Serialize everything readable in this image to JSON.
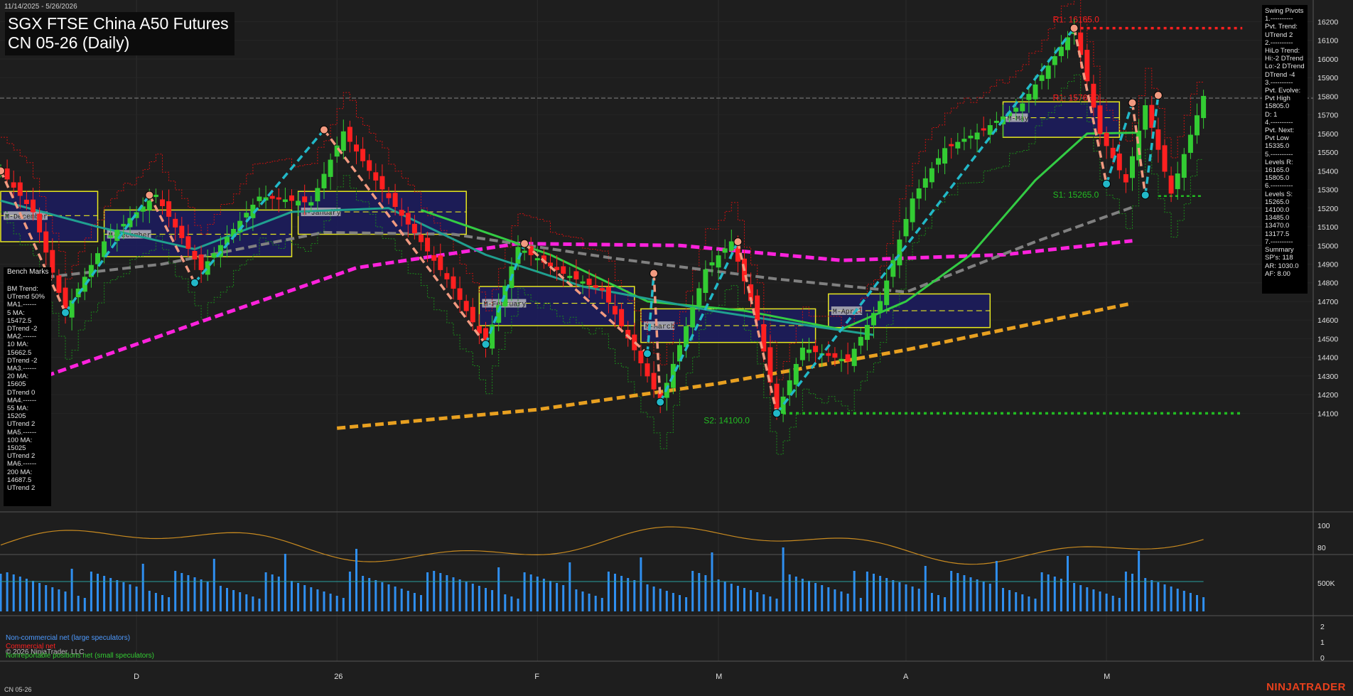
{
  "header": {
    "date_range": "11/14/2025 - 5/26/2026",
    "title": "SGX FTSE China A50 Futures",
    "subtitle": "CN 05-26 (Daily)"
  },
  "bench_marks": {
    "label": "Bench Marks",
    "lines": "BM Trend:\nUTrend 50%\nMA1.------\n5 MA:\n15472.5\nDTrend -2\nMA2.------\n10 MA:\n15662.5\nDTrend -2\nMA3.------\n20 MA:\n15605\nDTrend 0\nMA4.------\n55 MA:\n15205\nUTrend 2\nMA5.------\n100 MA:\n15025\nUTrend 2\nMA6.------\n200 MA:\n14687.5\nUTrend 2"
  },
  "swing_pivots": {
    "lines": "Swing Pivots\n1.----------\nPvt. Trend:\nUTrend 2\n2.----------\nHiLo Trend:\nHi:-2 DTrend\nLo:-2 DTrend\nDTrend -4\n3.----------\nPvt. Evolve:\nPvt High\n15805.0\nD: 1\n4.----------\nPvt. Next:\nPvt Low\n15335.0\n5.----------\nLevels R:\n16165.0\n15805.0\n6.----------\nLevels S:\n15265.0\n14100.0\n13485.0\n13470.0\n13177.5\n7.----------\nSummary\nSP's: 118\nAR: 1030.0\nAF: 8.00"
  },
  "legend": {
    "noncommercial": "Non-commercial net (large speculators)",
    "commercial": "Commercial net",
    "copyright": "© 2026 NinjaTrader, LLC",
    "nonreportable": "Nonreportable positions net (small speculators)"
  },
  "footer": {
    "symbol": "CN 05-26",
    "brand": "NINJATRADER"
  },
  "colors": {
    "background": "#1e1e1e",
    "up_candle": "#33cc33",
    "down_candle": "#ff2020",
    "ma_magenta": "#ff22dd",
    "ma_orange": "#e8a020",
    "ma_green": "#33cc44",
    "ma_gray": "#808080",
    "ma_teal": "#20a090",
    "swing_up": "#22b8c8",
    "swing_down": "#f29a80",
    "box_fill": "#1c1c60",
    "box_edge": "#e8e820",
    "volume": "#2f8ff0"
  },
  "chart_data": {
    "type": "candlestick",
    "y_axis_ticks": [
      14100,
      14200,
      14300,
      14400,
      14500,
      14600,
      14700,
      14800,
      14900,
      15000,
      15100,
      15200,
      15300,
      15400,
      15500,
      15600,
      15700,
      15800,
      15900,
      16000,
      16100,
      16200
    ],
    "x_axis_labels": [
      "D",
      "26",
      "F",
      "M",
      "A",
      "M"
    ],
    "x_axis_label_bars": [
      21,
      52,
      83,
      111,
      140,
      171
    ],
    "bar_count": 193,
    "pivot_levels": [
      {
        "label": "R1: 16165.0",
        "value": 16165,
        "color": "#ff2020"
      },
      {
        "label": "R1: 15765.0",
        "value": 15765,
        "color": "#ff2020"
      },
      {
        "label": "S1: 15265.0",
        "value": 15265,
        "color": "#22bb22"
      },
      {
        "label": "S2: 14100.0",
        "value": 14100,
        "color": "#22bb22"
      }
    ],
    "reference_line": 15790,
    "close_series": [
      {
        "bar": 0,
        "value": 15400
      },
      {
        "bar": 5,
        "value": 15180
      },
      {
        "bar": 10,
        "value": 14640
      },
      {
        "bar": 16,
        "value": 15020
      },
      {
        "bar": 24,
        "value": 15270
      },
      {
        "bar": 31,
        "value": 14870
      },
      {
        "bar": 40,
        "value": 15260
      },
      {
        "bar": 48,
        "value": 15230
      },
      {
        "bar": 53,
        "value": 15610
      },
      {
        "bar": 58,
        "value": 15350
      },
      {
        "bar": 65,
        "value": 15020
      },
      {
        "bar": 70,
        "value": 14770
      },
      {
        "bar": 75,
        "value": 14470
      },
      {
        "bar": 80,
        "value": 14990
      },
      {
        "bar": 87,
        "value": 14850
      },
      {
        "bar": 93,
        "value": 14760
      },
      {
        "bar": 98,
        "value": 14440
      },
      {
        "bar": 102,
        "value": 14160
      },
      {
        "bar": 109,
        "value": 14870
      },
      {
        "bar": 113,
        "value": 15020
      },
      {
        "bar": 117,
        "value": 14600
      },
      {
        "bar": 120,
        "value": 14100
      },
      {
        "bar": 124,
        "value": 14450
      },
      {
        "bar": 131,
        "value": 14380
      },
      {
        "bar": 136,
        "value": 14700
      },
      {
        "bar": 141,
        "value": 15250
      },
      {
        "bar": 146,
        "value": 15520
      },
      {
        "bar": 152,
        "value": 15620
      },
      {
        "bar": 158,
        "value": 15760
      },
      {
        "bar": 166,
        "value": 16165
      },
      {
        "bar": 170,
        "value": 15600
      },
      {
        "bar": 174,
        "value": 15340
      },
      {
        "bar": 177,
        "value": 15750
      },
      {
        "bar": 181,
        "value": 15280
      },
      {
        "bar": 186,
        "value": 15800
      }
    ],
    "swing_pivots": [
      {
        "bar": 0,
        "value": 15400
      },
      {
        "bar": 10,
        "value": 14640
      },
      {
        "bar": 23,
        "value": 15270
      },
      {
        "bar": 30,
        "value": 14800
      },
      {
        "bar": 50,
        "value": 15620
      },
      {
        "bar": 75,
        "value": 14470
      },
      {
        "bar": 81,
        "value": 15010
      },
      {
        "bar": 100,
        "value": 14420
      },
      {
        "bar": 101,
        "value": 14850
      },
      {
        "bar": 102,
        "value": 14160
      },
      {
        "bar": 114,
        "value": 15020
      },
      {
        "bar": 120,
        "value": 14100
      },
      {
        "bar": 166,
        "value": 16165
      },
      {
        "bar": 171,
        "value": 15330
      },
      {
        "bar": 175,
        "value": 15765
      },
      {
        "bar": 177,
        "value": 15270
      },
      {
        "bar": 179,
        "value": 15805
      }
    ],
    "moving_averages": [
      {
        "name": "200 MA",
        "color": "#e8a020",
        "points": [
          {
            "bar": 52,
            "value": 14020
          },
          {
            "bar": 83,
            "value": 14120
          },
          {
            "bar": 111,
            "value": 14260
          },
          {
            "bar": 140,
            "value": 14440
          },
          {
            "bar": 175,
            "value": 14690
          }
        ]
      },
      {
        "name": "100 MA",
        "color": "#ff22dd",
        "points": [
          {
            "bar": 7,
            "value": 14300
          },
          {
            "bar": 30,
            "value": 14580
          },
          {
            "bar": 55,
            "value": 14880
          },
          {
            "bar": 80,
            "value": 15010
          },
          {
            "bar": 105,
            "value": 15000
          },
          {
            "bar": 130,
            "value": 14920
          },
          {
            "bar": 155,
            "value": 14950
          },
          {
            "bar": 175,
            "value": 15025
          }
        ]
      },
      {
        "name": "55 MA",
        "color": "#808080",
        "points": [
          {
            "bar": 7,
            "value": 14830
          },
          {
            "bar": 25,
            "value": 14900
          },
          {
            "bar": 50,
            "value": 15070
          },
          {
            "bar": 70,
            "value": 15060
          },
          {
            "bar": 95,
            "value": 14930
          },
          {
            "bar": 120,
            "value": 14820
          },
          {
            "bar": 140,
            "value": 14750
          },
          {
            "bar": 160,
            "value": 15020
          },
          {
            "bar": 175,
            "value": 15205
          }
        ]
      },
      {
        "name": "20 MA",
        "color": "#33cc44",
        "points": [
          {
            "bar": 65,
            "value": 15190
          },
          {
            "bar": 85,
            "value": 14950
          },
          {
            "bar": 100,
            "value": 14700
          },
          {
            "bar": 115,
            "value": 14650
          },
          {
            "bar": 130,
            "value": 14550
          },
          {
            "bar": 140,
            "value": 14700
          },
          {
            "bar": 150,
            "value": 14950
          },
          {
            "bar": 160,
            "value": 15350
          },
          {
            "bar": 168,
            "value": 15600
          },
          {
            "bar": 176,
            "value": 15605
          }
        ]
      },
      {
        "name": "10 MA",
        "color": "#20a090",
        "points": [
          {
            "bar": 0,
            "value": 15240
          },
          {
            "bar": 15,
            "value": 15100
          },
          {
            "bar": 30,
            "value": 14980
          },
          {
            "bar": 45,
            "value": 15180
          },
          {
            "bar": 60,
            "value": 15200
          },
          {
            "bar": 75,
            "value": 14950
          },
          {
            "bar": 90,
            "value": 14780
          },
          {
            "bar": 110,
            "value": 14650
          },
          {
            "bar": 125,
            "value": 14570
          },
          {
            "bar": 135,
            "value": 14520
          }
        ]
      }
    ],
    "monthly_boxes": [
      {
        "label": "M-December",
        "bar_start": 0,
        "bar_end": 15,
        "high": 15290,
        "low": 15020,
        "mid": 15160
      },
      {
        "label": "M-December",
        "bar_start": 16,
        "bar_end": 45,
        "high": 15190,
        "low": 14940,
        "mid": 15060
      },
      {
        "label": "M-January",
        "bar_start": 46,
        "bar_end": 72,
        "high": 15290,
        "low": 15060,
        "mid": 15180
      },
      {
        "label": "M-February",
        "bar_start": 74,
        "bar_end": 98,
        "high": 14780,
        "low": 14570,
        "mid": 14690
      },
      {
        "label": "M-March",
        "bar_start": 99,
        "bar_end": 126,
        "high": 14660,
        "low": 14480,
        "mid": 14570
      },
      {
        "label": "M-April",
        "bar_start": 128,
        "bar_end": 153,
        "high": 14740,
        "low": 14560,
        "mid": 14650
      },
      {
        "label": "M-May",
        "bar_start": 155,
        "bar_end": 173,
        "high": 15770,
        "low": 15580,
        "mid": 15685
      }
    ],
    "oscillator": {
      "y_ticks": [
        80,
        100
      ]
    },
    "volume": {
      "y_ticks": [
        "500K"
      ]
    },
    "cot": {
      "y_ticks": [
        0,
        1,
        2
      ]
    }
  }
}
